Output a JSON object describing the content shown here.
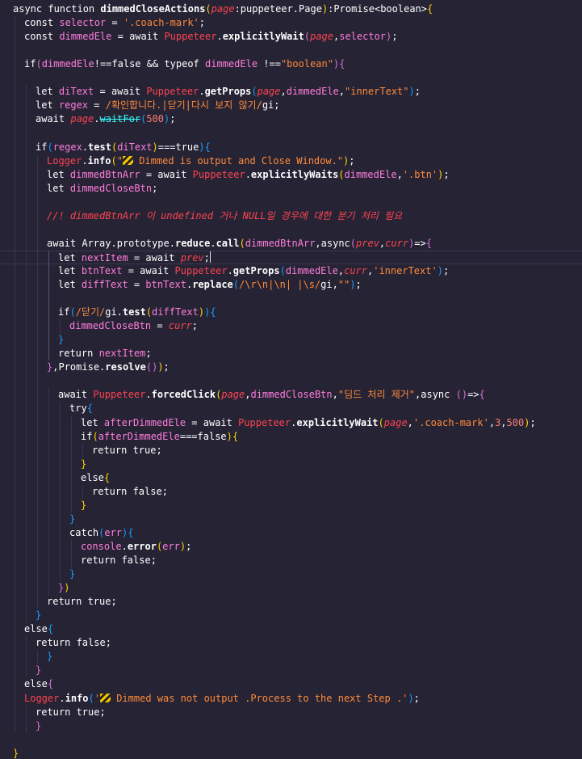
{
  "editor": {
    "theme_colors": {
      "background": "#262335",
      "keyword": "#ffffff",
      "variable": "#ff7edb",
      "parameter": "#fe4450",
      "string": "#ff8b39",
      "number": "#f97e72",
      "method": "#36f9f6",
      "bracket_1": "#ffd700",
      "bracket_2": "#da70d6",
      "bracket_3": "#179fff"
    },
    "icons": [
      "construction-icon"
    ],
    "lines": [
      [
        [
          "kw",
          "async function "
        ],
        [
          "fn",
          "dimmedCloseActions"
        ],
        [
          "b1",
          "("
        ],
        [
          "prm",
          "page"
        ],
        [
          "pl",
          ":puppeteer.Page"
        ],
        [
          "b1",
          ")"
        ],
        [
          "pl",
          ":Promise<boolean>"
        ],
        [
          "b1",
          "{"
        ]
      ],
      [
        [
          "kw",
          "const "
        ],
        [
          "var",
          "selector"
        ],
        [
          "pl",
          " = "
        ],
        [
          "str",
          "'.coach-mark'"
        ],
        [
          "pl",
          ";"
        ]
      ],
      [
        [
          "kw",
          "const "
        ],
        [
          "var",
          "dimmedEle"
        ],
        [
          "pl",
          " = "
        ],
        [
          "kw",
          "await "
        ],
        [
          "cls",
          "Puppeteer"
        ],
        [
          "pl",
          "."
        ],
        [
          "fn",
          "explicitlyWait"
        ],
        [
          "b2",
          "("
        ],
        [
          "prm",
          "page"
        ],
        [
          "pl",
          ","
        ],
        [
          "var",
          "selector"
        ],
        [
          "b2",
          ")"
        ],
        [
          "pl",
          ";"
        ]
      ],
      [],
      [
        [
          "kw",
          "if"
        ],
        [
          "b2",
          "("
        ],
        [
          "var",
          "dimmedEle"
        ],
        [
          "pl",
          "!=="
        ],
        [
          "kw",
          "false"
        ],
        [
          "pl",
          " && "
        ],
        [
          "kw",
          "typeof "
        ],
        [
          "var",
          "dimmedEle"
        ],
        [
          "pl",
          " !=="
        ],
        [
          "str",
          "\"boolean\""
        ],
        [
          "b2",
          ")"
        ],
        [
          "b2",
          "{"
        ]
      ],
      [],
      [
        [
          "kw",
          "let "
        ],
        [
          "var",
          "diText"
        ],
        [
          "pl",
          " = "
        ],
        [
          "kw",
          "await "
        ],
        [
          "cls",
          "Puppeteer"
        ],
        [
          "pl",
          "."
        ],
        [
          "fn",
          "getProps"
        ],
        [
          "b3",
          "("
        ],
        [
          "prm",
          "page"
        ],
        [
          "pl",
          ","
        ],
        [
          "var",
          "dimmedEle"
        ],
        [
          "pl",
          ","
        ],
        [
          "str",
          "\"innerText\""
        ],
        [
          "b3",
          ")"
        ],
        [
          "pl",
          ";"
        ]
      ],
      [
        [
          "kw",
          "let "
        ],
        [
          "var",
          "regex"
        ],
        [
          "pl",
          " = "
        ],
        [
          "rx",
          "/확인합니다.|닫기|다시 보지 않기/"
        ],
        [
          "kw",
          "gi"
        ],
        [
          "pl",
          ";"
        ]
      ],
      [
        [
          "kw",
          "await "
        ],
        [
          "prm",
          "page"
        ],
        [
          "pl",
          "."
        ],
        [
          "fn2 dep",
          "waitFor"
        ],
        [
          "b3",
          "("
        ],
        [
          "num",
          "500"
        ],
        [
          "b3",
          ")"
        ],
        [
          "pl",
          ";"
        ]
      ],
      [],
      [
        [
          "kw",
          "if"
        ],
        [
          "b3",
          "("
        ],
        [
          "var",
          "regex"
        ],
        [
          "pl",
          "."
        ],
        [
          "fn",
          "test"
        ],
        [
          "b1",
          "("
        ],
        [
          "var",
          "diText"
        ],
        [
          "b1",
          ")"
        ],
        [
          "pl",
          "==="
        ],
        [
          "kw",
          "true"
        ],
        [
          "b3",
          ")"
        ],
        [
          "b3",
          "{"
        ]
      ],
      [
        [
          "cls",
          "Logger"
        ],
        [
          "pl",
          "."
        ],
        [
          "fn",
          "info"
        ],
        [
          "b1",
          "("
        ],
        [
          "str",
          "\""
        ],
        [
          "icon",
          "construction-icon"
        ],
        [
          "str",
          " Dimmed is output and Close Window.\""
        ],
        [
          "b1",
          ")"
        ],
        [
          "pl",
          ";"
        ]
      ],
      [
        [
          "kw",
          "let "
        ],
        [
          "var",
          "dimmedBtnArr"
        ],
        [
          "pl",
          " = "
        ],
        [
          "kw",
          "await "
        ],
        [
          "cls",
          "Puppeteer"
        ],
        [
          "pl",
          "."
        ],
        [
          "fn",
          "explicitlyWaits"
        ],
        [
          "b1",
          "("
        ],
        [
          "var",
          "dimmedEle"
        ],
        [
          "pl",
          ","
        ],
        [
          "str",
          "'.btn'"
        ],
        [
          "b1",
          ")"
        ],
        [
          "pl",
          ";"
        ]
      ],
      [
        [
          "kw",
          "let "
        ],
        [
          "var",
          "dimmedCloseBtn"
        ],
        [
          "pl",
          ";"
        ]
      ],
      [],
      [
        [
          "cmt",
          "//! dimmedBtnArr 이 undefined 거나 NULL일 경우에 대한 분기 처리 필요"
        ]
      ],
      [],
      [
        [
          "kw",
          "await "
        ],
        [
          "kw",
          "Array"
        ],
        [
          "pl",
          "."
        ],
        [
          "kw",
          "prototype"
        ],
        [
          "pl",
          "."
        ],
        [
          "fn",
          "reduce"
        ],
        [
          "pl",
          "."
        ],
        [
          "fn",
          "call"
        ],
        [
          "b1",
          "("
        ],
        [
          "var",
          "dimmedBtnArr"
        ],
        [
          "pl",
          ","
        ],
        [
          "kw",
          "async"
        ],
        [
          "b2",
          "("
        ],
        [
          "prm",
          "prev"
        ],
        [
          "pl",
          ","
        ],
        [
          "prm",
          "curr"
        ],
        [
          "b2",
          ")"
        ],
        [
          "pl",
          "=>"
        ],
        [
          "b2",
          "{"
        ]
      ],
      [
        [
          "kw",
          "let "
        ],
        [
          "var",
          "nextItem"
        ],
        [
          "pl",
          " = "
        ],
        [
          "kw",
          "await "
        ],
        [
          "prm",
          "prev"
        ],
        [
          "pl",
          ";"
        ],
        [
          "caret",
          ""
        ]
      ],
      [
        [
          "kw",
          "let "
        ],
        [
          "var",
          "btnText"
        ],
        [
          "pl",
          " = "
        ],
        [
          "kw",
          "await "
        ],
        [
          "cls",
          "Puppeteer"
        ],
        [
          "pl",
          "."
        ],
        [
          "fn",
          "getProps"
        ],
        [
          "b3",
          "("
        ],
        [
          "var",
          "dimmedEle"
        ],
        [
          "pl",
          ","
        ],
        [
          "prm",
          "curr"
        ],
        [
          "pl",
          ","
        ],
        [
          "str",
          "'innerText'"
        ],
        [
          "b3",
          ")"
        ],
        [
          "pl",
          ";"
        ]
      ],
      [
        [
          "kw",
          "let "
        ],
        [
          "var",
          "diffText"
        ],
        [
          "pl",
          " = "
        ],
        [
          "var",
          "btnText"
        ],
        [
          "pl",
          "."
        ],
        [
          "fn",
          "replace"
        ],
        [
          "b3",
          "("
        ],
        [
          "rx",
          "/\\r\\n|\\n| |\\s/"
        ],
        [
          "kw",
          "gi"
        ],
        [
          "pl",
          ","
        ],
        [
          "str",
          "\"\""
        ],
        [
          "b3",
          ")"
        ],
        [
          "pl",
          ";"
        ]
      ],
      [],
      [
        [
          "kw",
          "if"
        ],
        [
          "b3",
          "("
        ],
        [
          "rx",
          "/닫기/"
        ],
        [
          "kw",
          "gi"
        ],
        [
          "pl",
          "."
        ],
        [
          "fn",
          "test"
        ],
        [
          "b1",
          "("
        ],
        [
          "var",
          "diffText"
        ],
        [
          "b1",
          ")"
        ],
        [
          "b3",
          ")"
        ],
        [
          "b3",
          "{"
        ]
      ],
      [
        [
          "var",
          "dimmedCloseBtn"
        ],
        [
          "pl",
          " = "
        ],
        [
          "prm",
          "curr"
        ],
        [
          "pl",
          ";"
        ]
      ],
      [
        [
          "b3",
          "}"
        ]
      ],
      [
        [
          "kw",
          "return "
        ],
        [
          "var",
          "nextItem"
        ],
        [
          "pl",
          ";"
        ]
      ],
      [
        [
          "b2",
          "}"
        ],
        [
          "pl",
          ","
        ],
        [
          "kw",
          "Promise"
        ],
        [
          "pl",
          "."
        ],
        [
          "fn",
          "resolve"
        ],
        [
          "b2",
          "()"
        ],
        [
          "b1",
          ")"
        ],
        [
          "pl",
          ";"
        ]
      ],
      [],
      [
        [
          "kw",
          "await "
        ],
        [
          "cls",
          "Puppeteer"
        ],
        [
          "pl",
          "."
        ],
        [
          "fn",
          "forcedClick"
        ],
        [
          "b1",
          "("
        ],
        [
          "prm",
          "page"
        ],
        [
          "pl",
          ","
        ],
        [
          "var",
          "dimmedCloseBtn"
        ],
        [
          "pl",
          ","
        ],
        [
          "str",
          "\"딤드 처리 제거\""
        ],
        [
          "pl",
          ","
        ],
        [
          "kw",
          "async "
        ],
        [
          "b2",
          "()"
        ],
        [
          "pl",
          "=>"
        ],
        [
          "b2",
          "{"
        ]
      ],
      [
        [
          "kw",
          "try"
        ],
        [
          "b3",
          "{"
        ]
      ],
      [
        [
          "kw",
          "let "
        ],
        [
          "var",
          "afterDimmedEle"
        ],
        [
          "pl",
          " = "
        ],
        [
          "kw",
          "await "
        ],
        [
          "cls",
          "Puppeteer"
        ],
        [
          "pl",
          "."
        ],
        [
          "fn",
          "explicitlyWait"
        ],
        [
          "b1",
          "("
        ],
        [
          "prm",
          "page"
        ],
        [
          "pl",
          ","
        ],
        [
          "str",
          "'.coach-mark'"
        ],
        [
          "pl",
          ","
        ],
        [
          "num",
          "3"
        ],
        [
          "pl",
          ","
        ],
        [
          "num",
          "500"
        ],
        [
          "b1",
          ")"
        ],
        [
          "pl",
          ";"
        ]
      ],
      [
        [
          "kw",
          "if"
        ],
        [
          "b1",
          "("
        ],
        [
          "var",
          "afterDimmedEle"
        ],
        [
          "pl",
          "==="
        ],
        [
          "kw",
          "false"
        ],
        [
          "b1",
          ")"
        ],
        [
          "b1",
          "{"
        ]
      ],
      [
        [
          "kw",
          "return "
        ],
        [
          "kw",
          "true"
        ],
        [
          "pl",
          ";"
        ]
      ],
      [
        [
          "b1",
          "}"
        ]
      ],
      [
        [
          "kw",
          "else"
        ],
        [
          "b1",
          "{"
        ]
      ],
      [
        [
          "kw",
          "return "
        ],
        [
          "kw",
          "false"
        ],
        [
          "pl",
          ";"
        ]
      ],
      [
        [
          "b1",
          "}"
        ]
      ],
      [
        [
          "b3",
          "}"
        ]
      ],
      [
        [
          "kw",
          "catch"
        ],
        [
          "b3",
          "("
        ],
        [
          "var",
          "err"
        ],
        [
          "b3",
          ")"
        ],
        [
          "b3",
          "{"
        ]
      ],
      [
        [
          "var",
          "console"
        ],
        [
          "pl",
          "."
        ],
        [
          "fn",
          "error"
        ],
        [
          "b1",
          "("
        ],
        [
          "var",
          "err"
        ],
        [
          "b1",
          ")"
        ],
        [
          "pl",
          ";"
        ]
      ],
      [
        [
          "kw",
          "return "
        ],
        [
          "kw",
          "false"
        ],
        [
          "pl",
          ";"
        ]
      ],
      [
        [
          "b3",
          "}"
        ]
      ],
      [
        [
          "b2",
          "}"
        ],
        [
          "b1",
          ")"
        ]
      ],
      [
        [
          "kw",
          "return "
        ],
        [
          "kw",
          "true"
        ],
        [
          "pl",
          ";"
        ]
      ],
      [
        [
          "b3",
          "}"
        ]
      ],
      [
        [
          "kw",
          "else"
        ],
        [
          "b3",
          "{"
        ]
      ],
      [
        [
          "kw",
          "return "
        ],
        [
          "kw",
          "false"
        ],
        [
          "pl",
          ";"
        ]
      ],
      [
        [
          "b3",
          "}"
        ]
      ],
      [
        [
          "b2",
          "}"
        ]
      ],
      [
        [
          "kw",
          "else"
        ],
        [
          "b2",
          "{"
        ]
      ],
      [
        [
          "cls",
          "Logger"
        ],
        [
          "pl",
          "."
        ],
        [
          "fn",
          "info"
        ],
        [
          "b3",
          "("
        ],
        [
          "str",
          "'"
        ],
        [
          "icon",
          "construction-icon"
        ],
        [
          "str",
          " Dimmed was not output .Process to the next Step .'"
        ],
        [
          "b3",
          ")"
        ],
        [
          "pl",
          ";"
        ]
      ],
      [
        [
          "kw",
          "return "
        ],
        [
          "kw",
          "true"
        ],
        [
          "pl",
          ";"
        ]
      ],
      [
        [
          "b2",
          "}"
        ]
      ],
      [],
      [
        [
          "b1",
          "}"
        ]
      ]
    ]
  }
}
